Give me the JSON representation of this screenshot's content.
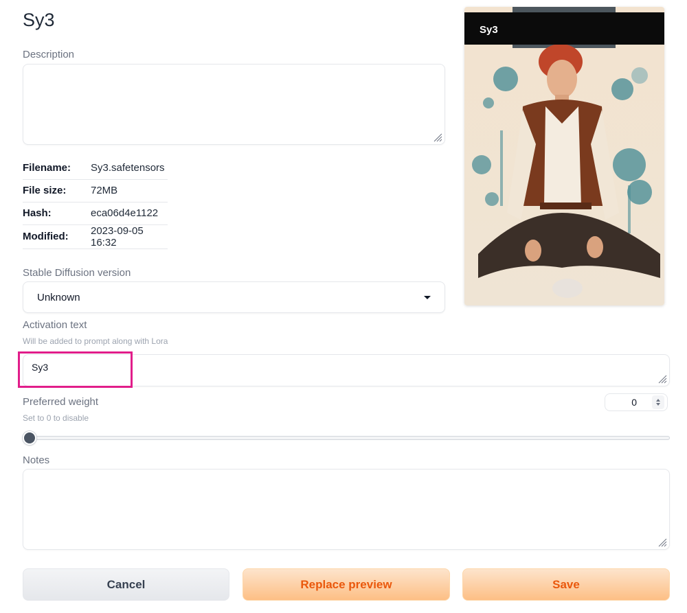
{
  "header": {
    "title": "Sy3"
  },
  "description": {
    "label": "Description",
    "value": ""
  },
  "file_info": [
    {
      "key": "Filename:",
      "value": "Sy3.safetensors"
    },
    {
      "key": "File size:",
      "value": "72MB"
    },
    {
      "key": "Hash:",
      "value": "eca06d4e1122"
    },
    {
      "key": "Modified:",
      "value": "2023-09-05 16:32"
    }
  ],
  "sd_version": {
    "label": "Stable Diffusion version",
    "selected": "Unknown"
  },
  "preview": {
    "label": "Sy3",
    "icon": "preview-image"
  },
  "activation": {
    "label": "Activation text",
    "hint": "Will be added to prompt along with Lora",
    "value": "Sy3"
  },
  "weight": {
    "label": "Preferred weight",
    "hint": "Set to 0 to disable",
    "value": "0",
    "slider_fraction": 0
  },
  "notes": {
    "label": "Notes",
    "value": ""
  },
  "buttons": {
    "cancel": "Cancel",
    "replace_preview": "Replace preview",
    "save": "Save"
  },
  "colors": {
    "accent": "#ea580c",
    "highlight": "#e11d8a"
  }
}
